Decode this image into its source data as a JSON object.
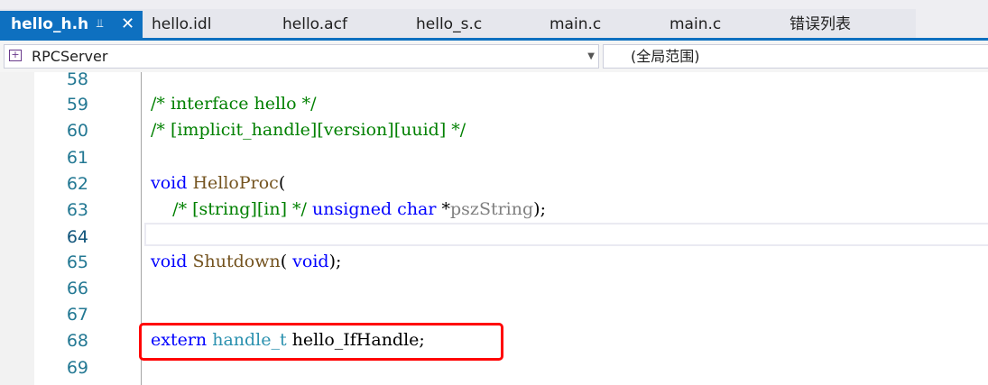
{
  "tabs": [
    {
      "label": "hello_h.h",
      "active": true
    },
    {
      "label": "hello.idl"
    },
    {
      "label": "hello.acf"
    },
    {
      "label": "hello_s.c"
    },
    {
      "label": "main.c"
    },
    {
      "label": "main.c"
    },
    {
      "label": "错误列表"
    }
  ],
  "tab_icons": {
    "pin": "pin-icon",
    "close": "close-icon"
  },
  "navbar": {
    "project": "RPCServer",
    "scope": "(全局范围)"
  },
  "editor": {
    "current_line": "64",
    "lines": [
      {
        "no": "58",
        "text": ""
      },
      {
        "no": "59",
        "text": "/* interface hello */"
      },
      {
        "no": "60",
        "text": "/* [implicit_handle][version][uuid] */"
      },
      {
        "no": "61",
        "text": ""
      },
      {
        "no": "62",
        "text": "void HelloProc("
      },
      {
        "no": "63",
        "text": "    /* [string][in] */ unsigned char *pszString);"
      },
      {
        "no": "64",
        "text": ""
      },
      {
        "no": "65",
        "text": "void Shutdown( void);"
      },
      {
        "no": "66",
        "text": ""
      },
      {
        "no": "67",
        "text": ""
      },
      {
        "no": "68",
        "text": "extern handle_t hello_IfHandle;"
      },
      {
        "no": "69",
        "text": ""
      }
    ],
    "tokens": {
      "l59": "/* interface hello */",
      "l60": "/* [implicit_handle][version][uuid] */",
      "l62_kw": "void",
      "l62_fn": "HelloProc",
      "l62_rest": "(",
      "l63_indent": "    ",
      "l63_cmt": "/* [string][in] */",
      "l63_kw1": "unsigned",
      "l63_kw2": "char",
      "l63_star": "*",
      "l63_prm": "pszString",
      "l63_rest": ");",
      "l65_kw": "void",
      "l65_fn": "Shutdown",
      "l65_mid": "(",
      "l65_kw2": "void",
      "l65_rest": ");",
      "l68_kw": "extern",
      "l68_typ": "handle_t",
      "l68_rest": "hello_IfHandle;"
    }
  },
  "colors": {
    "accent": "#0e70c0",
    "comment": "#008000",
    "keyword": "#0000ff",
    "type": "#2b91af",
    "highlight_box": "#ff0000"
  }
}
